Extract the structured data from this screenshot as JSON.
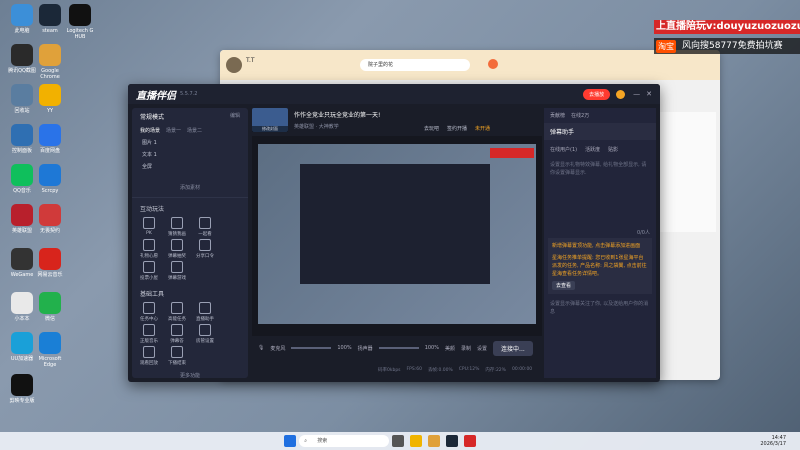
{
  "desktop": {
    "icons": [
      {
        "label": "此电脑",
        "color": "#3c8fd8"
      },
      {
        "label": "steam",
        "color": "#1b2838"
      },
      {
        "label": "Logitech G HUB",
        "color": "#111"
      },
      {
        "label": "腾讯QQ截图",
        "color": "#2a2a2a"
      },
      {
        "label": "Google Chrome",
        "color": "#e0a13a"
      },
      {
        "label": "回收站",
        "color": "#5a7da0"
      },
      {
        "label": "YY",
        "color": "#f2b100"
      },
      {
        "label": "控制面板",
        "color": "#2f6fb2"
      },
      {
        "label": "百度网盘",
        "color": "#2a73e8"
      },
      {
        "label": "QQ音乐",
        "color": "#0fbf5c"
      },
      {
        "label": "Scrcpy",
        "color": "#1e78d6"
      },
      {
        "label": "英雄联盟",
        "color": "#b8202c"
      },
      {
        "label": "无畏契约",
        "color": "#d03a3a"
      },
      {
        "label": "WeGame",
        "color": "#333"
      },
      {
        "label": "网易云音乐",
        "color": "#d8241c"
      },
      {
        "label": "小本本",
        "color": "#e9e9e9"
      },
      {
        "label": "微信",
        "color": "#22b14c"
      },
      {
        "label": "UU加速器",
        "color": "#1aa0d8"
      },
      {
        "label": "Microsoft Edge",
        "color": "#1a7fd6"
      },
      {
        "label": "剪映专业版",
        "color": "#111"
      }
    ]
  },
  "banner": {
    "line1": "上直播陪玩v:douyuzuozuozuo",
    "taobao": "淘宝",
    "line2": "风向搜58777免费拍坑赛"
  },
  "back_window": {
    "user": "T.T",
    "search_text": "院子里的花"
  },
  "app": {
    "logo": "直播伴侣",
    "version": "5.5.7.2",
    "live_status": "去播放",
    "title": "作作全竞业只玩全竞业的第一天!",
    "cover_label": "修改封面",
    "partition": "英雄联盟 · 大神教学",
    "top_actions": [
      "去玩吧",
      "签约开播",
      "未开通"
    ],
    "left": {
      "mode_label": "常规模式",
      "edit": "编辑",
      "scene_tabs": [
        "我的场景",
        "场景一",
        "场景二"
      ],
      "sources": [
        "图片 1",
        "文本 1",
        "全屏"
      ],
      "add_source": "添加素材",
      "interaction_title": "互动玩法",
      "interaction_tools": [
        "PK",
        "猜猜我画",
        "一起看",
        "礼物心愿",
        "弹幕抽奖",
        "分享口令",
        "投票小屋",
        "弹幕游戏"
      ],
      "basic_title": "基础工具",
      "basic_tools": [
        "任务中心",
        "高能任务",
        "直播助手",
        "正版音乐",
        "弹幕答",
        "房管设置",
        "观看回放",
        "下播结束"
      ],
      "more_tools": "更多功能"
    },
    "bottom": {
      "mic_label": "麦克风",
      "mic_volume": "100%",
      "speaker_label": "扬声器",
      "speaker_volume": "100%",
      "tools": [
        "美颜",
        "录制",
        "设置"
      ],
      "go_live": "连接中...",
      "stats": [
        "码率0kbps",
        "FPS:60",
        "丢帧:0.00%",
        "CPU:12%",
        "内存:22%",
        "00:00:00"
      ]
    },
    "right": {
      "tabs": [
        "贡献榜",
        "在线2万"
      ],
      "assistant": "弹幕助手",
      "sub_tabs": [
        "在线用户(1)",
        "活跃度",
        "贴影"
      ],
      "hint": "设置显示礼物特效弹幕, 给礼物全部显示, 请你设置弹幕显示.",
      "fans": "0/0人",
      "msgs": [
        "新增弹幕置顶功能, 点击弹幕添加进画面",
        "星海任务推单提醒: 您已收到1张星海平台派发的任务, 产品名称: 风之袋翼, 点击前往星海查看任务详情吧。"
      ],
      "view_more": "去查看",
      "foot_hint": "设置显示弹幕关注了你, 以及送给用户你的消息"
    }
  },
  "taskbar": {
    "search": "搜索",
    "time": "14:47",
    "date": "2026/3/17"
  }
}
